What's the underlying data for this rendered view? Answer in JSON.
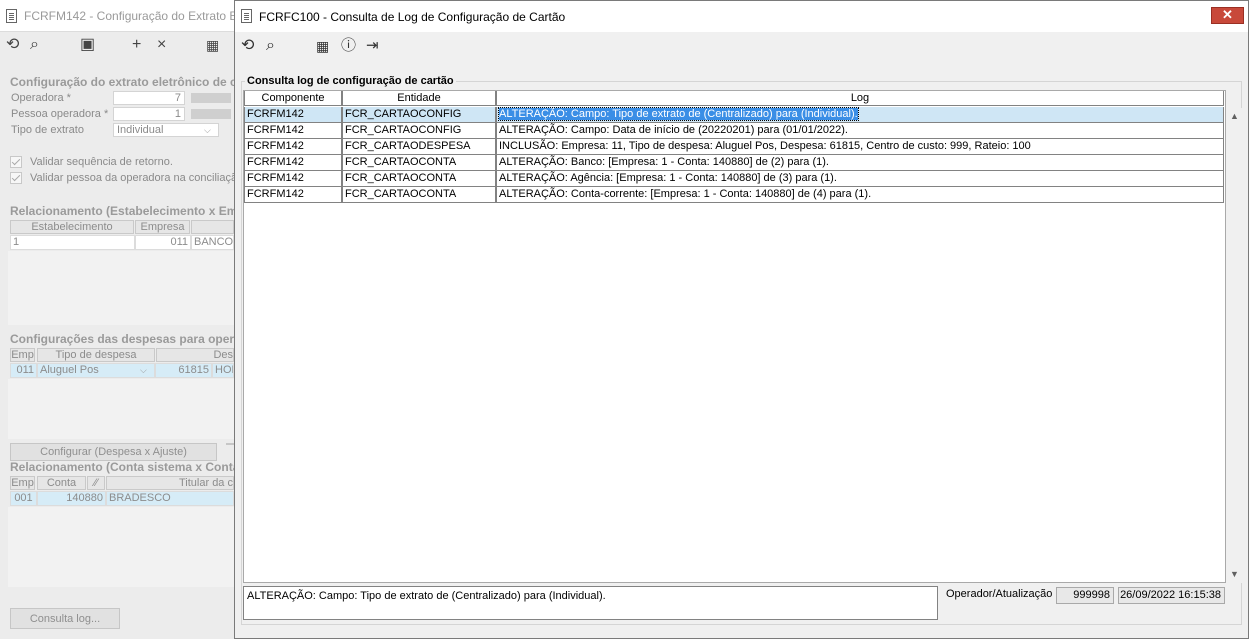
{
  "background_window": {
    "title": "FCRFM142 - Configuração do Extrato Ele",
    "section_extract": "Configuração do extrato eletrônico de ca",
    "operadora_label": "Operadora *",
    "operadora_value": "7",
    "pessoa_label": "Pessoa operadora *",
    "pessoa_value": "1",
    "tipo_label": "Tipo de extrato",
    "tipo_value": "Individual",
    "check1_label": "Validar sequência de retorno.",
    "check2_label": "Validar pessoa da operadora na conciliaçã",
    "section_rel": "Relacionamento (Estabelecimento x Emp",
    "rel_headers": [
      "Estabelecimento",
      "Empresa"
    ],
    "rel_row": {
      "estab": "1",
      "empresa": "011",
      "banco": "BANCO"
    },
    "section_desp": "Configurações das despesas para opera",
    "desp_headers": [
      "Emp",
      "Tipo de despesa",
      "Des"
    ],
    "desp_row": {
      "emp": "011",
      "tipo": "Aluguel Pos",
      "cod": "61815",
      "desc": "HON"
    },
    "config_button": "Configurar (Despesa x Ajuste)",
    "section_conta": "Relacionamento (Conta sistema x Conta",
    "conta_headers": [
      "Emp",
      "Conta",
      "Titular da c"
    ],
    "conta_row": {
      "emp": "001",
      "conta": "140880",
      "titular": "BRADESCO"
    },
    "consulta_button": "Consulta log..."
  },
  "dialog": {
    "title": "FCRFC100 - Consulta de Log de Configuração de Cartão",
    "close_label": "✕",
    "group_title": "Consulta log de configuração de cartão",
    "columns": [
      "Componente",
      "Entidade",
      "Log"
    ],
    "rows": [
      {
        "componente": "FCRFM142",
        "entidade": "FCR_CARTAOCONFIG",
        "log": "ALTERAÇÃO: Campo: Tipo de extrato de (Centralizado) para (Individual)."
      },
      {
        "componente": "FCRFM142",
        "entidade": "FCR_CARTAOCONFIG",
        "log": "ALTERAÇÃO: Campo: Data de início de (20220201) para (01/01/2022)."
      },
      {
        "componente": "FCRFM142",
        "entidade": "FCR_CARTAODESPESA",
        "log": "INCLUSÃO: Empresa: 11, Tipo de despesa: Aluguel Pos, Despesa: 61815, Centro de custo: 999, Rateio: 100"
      },
      {
        "componente": "FCRFM142",
        "entidade": "FCR_CARTAOCONTA",
        "log": "ALTERAÇÃO: Banco: [Empresa: 1 - Conta: 140880] de (2) para (1)."
      },
      {
        "componente": "FCRFM142",
        "entidade": "FCR_CARTAOCONTA",
        "log": "ALTERAÇÃO: Agência: [Empresa: 1 - Conta: 140880] de (3) para (1)."
      },
      {
        "componente": "FCRFM142",
        "entidade": "FCR_CARTAOCONTA",
        "log": "ALTERAÇÃO: Conta-corrente: [Empresa: 1 - Conta: 140880] de (4) para (1)."
      }
    ],
    "detail_text": "ALTERAÇÃO: Campo: Tipo de extrato de (Centralizado) para (Individual).",
    "operador_label": "Operador/Atualização",
    "operador_value": "999998",
    "atualizacao_value": "26/09/2022 16:15:38"
  }
}
